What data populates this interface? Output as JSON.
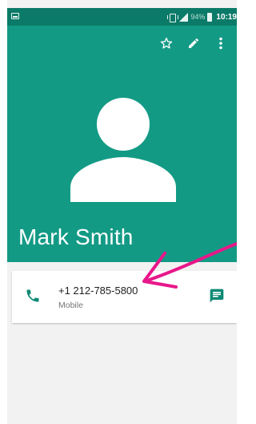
{
  "status_bar": {
    "battery_percent": "94%",
    "time": "10:19",
    "icons": [
      "screenshot-icon",
      "vibrate-icon",
      "signal-icon",
      "battery-icon"
    ]
  },
  "header": {
    "background_color": "#139a85",
    "actions": [
      {
        "name": "favorite-star-icon"
      },
      {
        "name": "edit-pencil-icon"
      },
      {
        "name": "more-options-icon"
      }
    ],
    "contact_name": "Mark Smith"
  },
  "phone_entry": {
    "number": "+1 212-785-5800",
    "type": "Mobile",
    "accent_color": "#0f8a75"
  },
  "annotation": {
    "arrow_color": "#e8178a"
  }
}
